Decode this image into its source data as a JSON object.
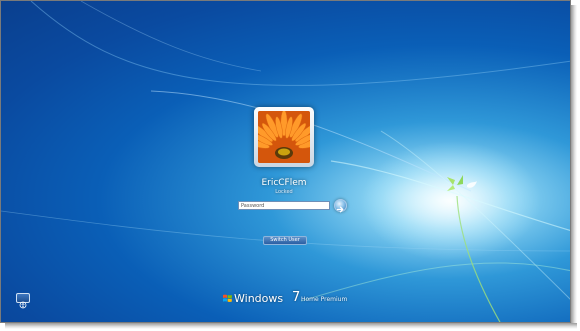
{
  "screen": {
    "background_colors": {
      "deep": "#0a3f8e",
      "mid": "#2f98d8",
      "glow": "#e8fbff"
    }
  },
  "user": {
    "name": "EricCFlem",
    "status": "Locked",
    "avatar": "orange-gerbera-flower-picture"
  },
  "password_field": {
    "placeholder": "Password",
    "value": ""
  },
  "submit_icon": "arrow-right-icon",
  "switch_user": {
    "label": "Switch User"
  },
  "ease_of_access": {
    "icon": "ease-of-access-icon"
  },
  "branding": {
    "logo_icon": "windows-flag-icon",
    "word": "Windows",
    "version": "7",
    "edition": "Home Premium"
  }
}
